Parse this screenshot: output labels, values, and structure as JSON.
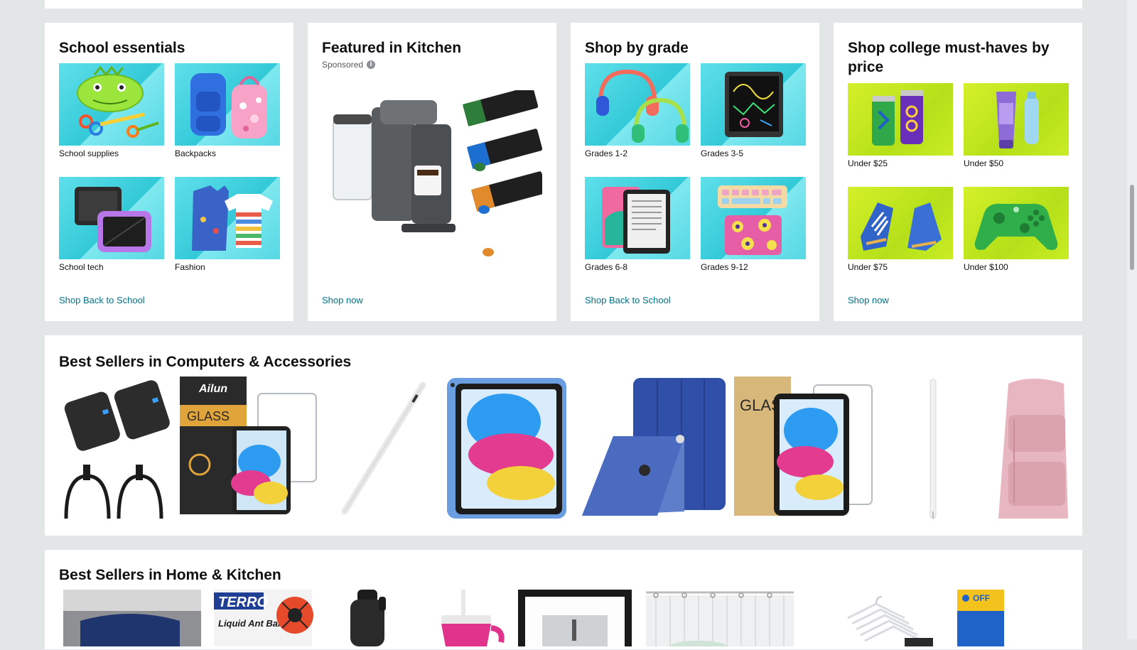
{
  "cards": {
    "school_essentials": {
      "title": "School essentials",
      "tiles": [
        {
          "label": "School supplies",
          "icon": "pencil-case-icon"
        },
        {
          "label": "Backpacks",
          "icon": "backpack-icon"
        },
        {
          "label": "School tech",
          "icon": "tablet-icon"
        },
        {
          "label": "Fashion",
          "icon": "clothing-icon"
        }
      ],
      "link": "Shop Back to School"
    },
    "featured_kitchen": {
      "title": "Featured in Kitchen",
      "sponsored": "Sponsored",
      "product_icon": "coffee-machine-icon",
      "link": "Shop now"
    },
    "shop_by_grade": {
      "title": "Shop by grade",
      "tiles": [
        {
          "label": "Grades 1-2",
          "icon": "headphones-icon"
        },
        {
          "label": "Grades 3-5",
          "icon": "drawing-tablet-icon"
        },
        {
          "label": "Grades 6-8",
          "icon": "ereader-icon"
        },
        {
          "label": "Grades 9-12",
          "icon": "keyboard-icon"
        }
      ],
      "link": "Shop Back to School"
    },
    "college_by_price": {
      "title": "Shop college must-haves by price",
      "tiles": [
        {
          "label": "Under $25",
          "icon": "soda-can-icon"
        },
        {
          "label": "Under $50",
          "icon": "skincare-tube-icon"
        },
        {
          "label": "Under $75",
          "icon": "sneaker-icon"
        },
        {
          "label": "Under $100",
          "icon": "game-controller-icon"
        }
      ],
      "link": "Shop now"
    }
  },
  "best_sellers_computers": {
    "title": "Best Sellers in Computers & Accessories",
    "products": [
      {
        "icon": "usb-charger-icon"
      },
      {
        "icon": "screen-protector-icon",
        "brand_text": "Ailun",
        "box_text": "GLASS"
      },
      {
        "icon": "stylus-pen-icon"
      },
      {
        "icon": "ipad-icon"
      },
      {
        "icon": "tablet-case-icon"
      },
      {
        "icon": "screen-protector-icon",
        "box_text": "GLAS"
      },
      {
        "icon": "stylus-pen-icon"
      },
      {
        "icon": "laptop-backpack-icon"
      }
    ]
  },
  "best_sellers_home": {
    "title": "Best Sellers in Home & Kitchen",
    "products": [
      {
        "icon": "pillow-icon"
      },
      {
        "icon": "ant-bait-icon",
        "brand_text": "TERRO",
        "box_text": "Liquid Ant Baits"
      },
      {
        "icon": "water-bottle-icon"
      },
      {
        "icon": "tumbler-icon"
      },
      {
        "icon": "picture-frame-icon"
      },
      {
        "icon": "shower-curtain-icon"
      },
      {
        "icon": "hangers-icon"
      },
      {
        "icon": "detergent-box-icon",
        "box_text": "OFF"
      }
    ]
  },
  "colors": {
    "link": "#007185",
    "page_bg": "#e3e6e6",
    "card_bg": "#ffffff"
  }
}
